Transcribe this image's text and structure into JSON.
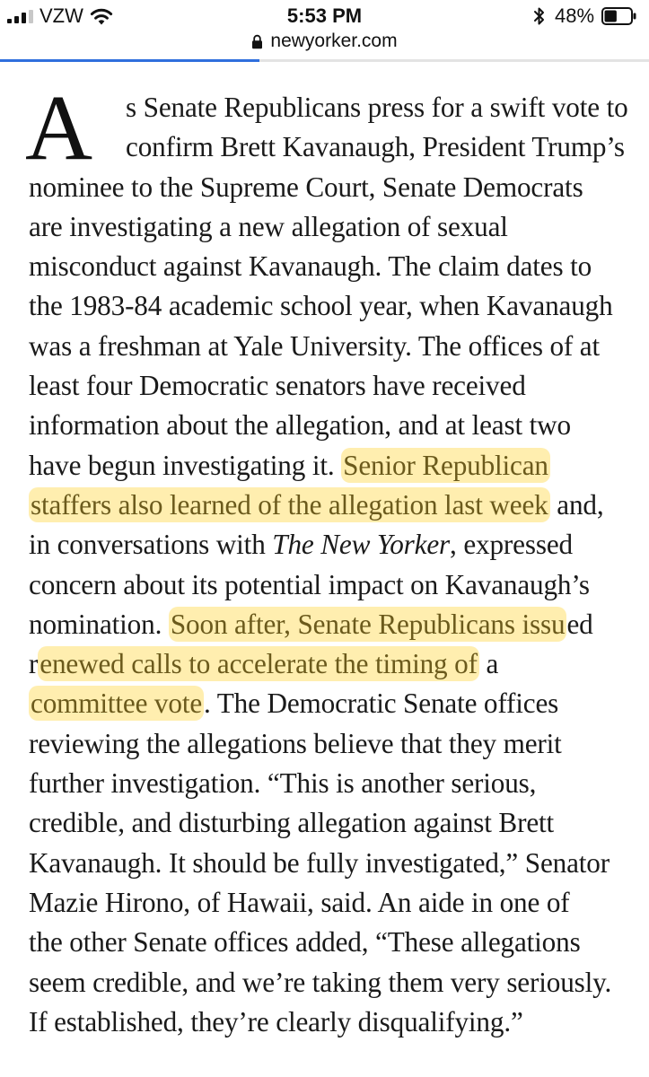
{
  "status_bar": {
    "carrier": "VZW",
    "time": "5:53 PM",
    "battery_percent_label": "48%",
    "battery_level": 0.48,
    "signal_bars_filled": 3,
    "signal_bars_total": 4,
    "icons": [
      "signal-bars-icon",
      "wifi-icon",
      "bluetooth-icon",
      "battery-icon"
    ]
  },
  "browser": {
    "url": "newyorker.com",
    "lock_icon": "lock-icon",
    "load_progress": 0.4,
    "load_color": "#2f6fdd"
  },
  "colors": {
    "highlight": "#fcd34d",
    "highlight_text": "#6b5a1c",
    "body_text": "#1a1a1a"
  },
  "article": {
    "dropcap": "A",
    "lines": [
      [
        {
          "t": "s Senate Republicans press for a swift vote to"
        }
      ],
      [
        {
          "t": "confirm Brett Kavanaugh, President Trump’s"
        }
      ],
      [
        {
          "t": "nominee to the Supreme Court, Senate Democrats"
        }
      ],
      [
        {
          "t": "are investigating a new allegation of sexual"
        }
      ],
      [
        {
          "t": "misconduct against Kavanaugh. The claim dates to"
        }
      ],
      [
        {
          "t": "the 1983-84 academic school year, when Kavanaugh"
        }
      ],
      [
        {
          "t": "was a freshman at Yale University. The offices of at"
        }
      ],
      [
        {
          "t": "least four Democratic senators have received"
        }
      ],
      [
        {
          "t": "information about the allegation, and at least two"
        }
      ],
      [
        {
          "t": "have begun investigating it. "
        },
        {
          "t": "Senior Republican",
          "hl": true
        }
      ],
      [
        {
          "t": "staffers also learned of the allegation last week",
          "hl": true
        },
        {
          "t": " and,"
        }
      ],
      [
        {
          "t": "in conversations with "
        },
        {
          "t": "The New Yorker",
          "i": true
        },
        {
          "t": ", expressed"
        }
      ],
      [
        {
          "t": "concern about its potential impact on Kavanaugh’s"
        }
      ],
      [
        {
          "t": "nomination. "
        },
        {
          "t": "Soon after, Senate Republicans issu",
          "hl": true
        },
        {
          "t": "ed"
        }
      ],
      [
        {
          "t": "r"
        },
        {
          "t": "enewed calls to accelerate the timing of",
          "hl": true
        },
        {
          "t": " a"
        }
      ],
      [
        {
          "t": "committee vote",
          "hl": true
        },
        {
          "t": ". The Democratic Senate offices"
        }
      ],
      [
        {
          "t": "reviewing the allegations believe that they merit"
        }
      ],
      [
        {
          "t": "further investigation. “This is another serious,"
        }
      ],
      [
        {
          "t": "credible, and disturbing allegation against Brett"
        }
      ],
      [
        {
          "t": "Kavanaugh. It should be fully investigated,” Senator"
        }
      ],
      [
        {
          "t": "Mazie Hirono, of Hawaii, said. An aide in one of"
        }
      ],
      [
        {
          "t": "the other Senate offices added, “These allegations"
        }
      ],
      [
        {
          "t": "seem credible, and we’re taking them very seriously."
        }
      ],
      [
        {
          "t": "If established, they’re clearly disqualifying.”"
        }
      ]
    ]
  }
}
